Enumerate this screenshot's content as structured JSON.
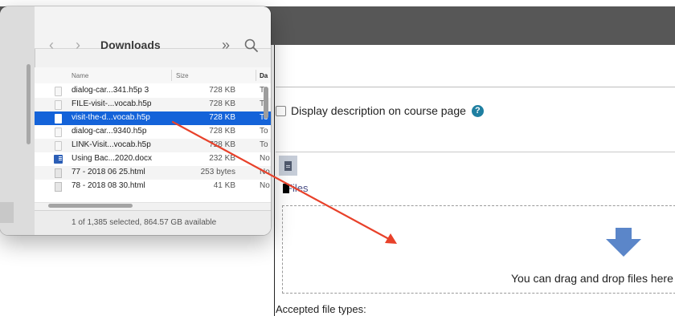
{
  "finder": {
    "title": "Downloads",
    "back_icon": "‹",
    "forward_icon": "›",
    "more_icon": "»",
    "columns": {
      "name": "Name",
      "size": "Size",
      "date": "Da"
    },
    "files": [
      {
        "name": "dialog-car...341.h5p 3",
        "size": "728 KB",
        "date": "To",
        "icon": "file-icon"
      },
      {
        "name": "FILE-visit-...vocab.h5p",
        "size": "728 KB",
        "date": "To",
        "icon": "file-icon"
      },
      {
        "name": "visit-the-d...vocab.h5p",
        "size": "728 KB",
        "date": "To",
        "icon": "file-icon",
        "selected": true
      },
      {
        "name": "dialog-car...9340.h5p",
        "size": "728 KB",
        "date": "To",
        "icon": "file-icon"
      },
      {
        "name": "LINK-Visit...vocab.h5p",
        "size": "728 KB",
        "date": "To",
        "icon": "file-icon"
      },
      {
        "name": "Using Bac...2020.docx",
        "size": "232 KB",
        "date": "No",
        "icon": "word-icon"
      },
      {
        "name": "77 - 2018 06 25.html",
        "size": "253 bytes",
        "date": "No",
        "icon": "html-icon"
      },
      {
        "name": "78 - 2018 08 30.html",
        "size": "41 KB",
        "date": "No",
        "icon": "html-icon"
      }
    ],
    "status": "1 of 1,385 selected, 864.57 GB available"
  },
  "moodle": {
    "display_description_label": "Display description on course page",
    "help_icon_glyph": "?",
    "files_tab_label": "Files",
    "dropzone_text": "You can drag and drop files here t",
    "accepted_file_types_label": "Accepted file types:"
  },
  "colors": {
    "selection": "#1463d9",
    "moodle_topbar": "#575757",
    "drag_arrow": "#e8412a",
    "drop_arrow": "#5b86c9",
    "help_icon": "#1f7fa1"
  }
}
